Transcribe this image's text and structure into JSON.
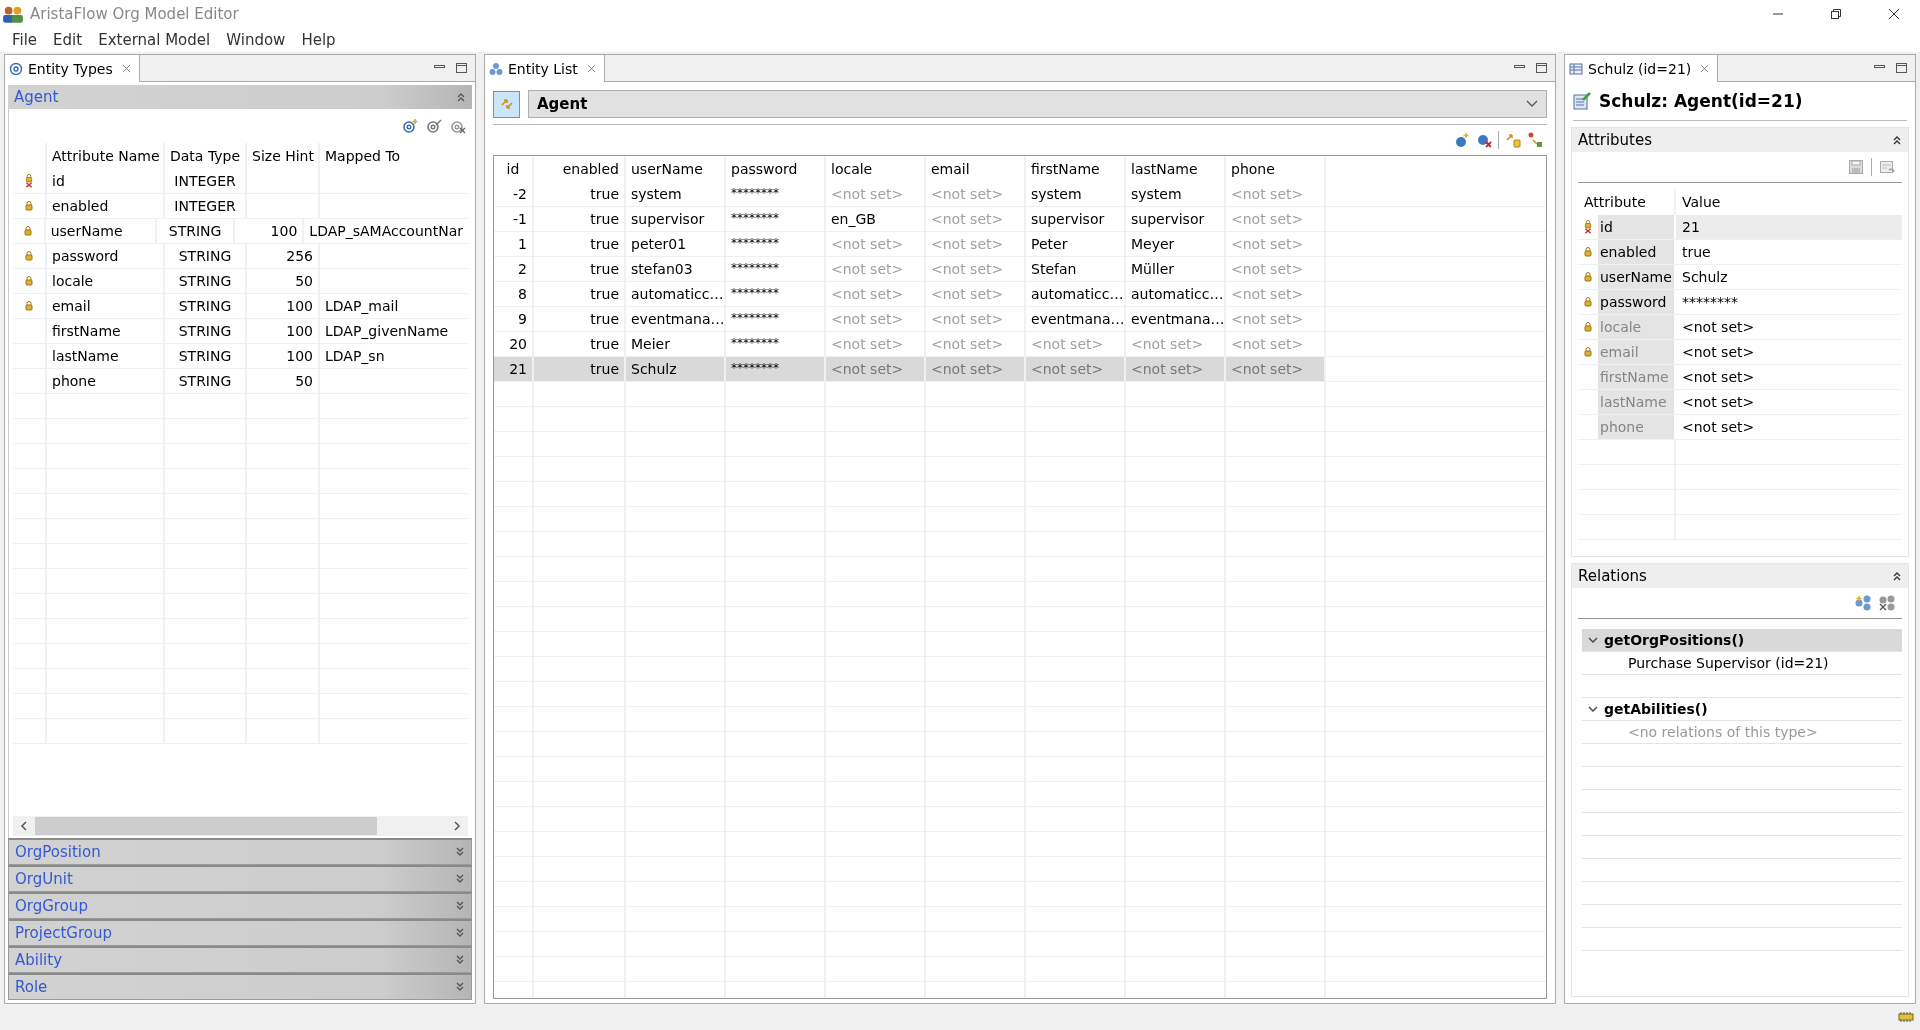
{
  "window": {
    "title": "AristaFlow Org Model Editor"
  },
  "menu": [
    "File",
    "Edit",
    "External Model",
    "Window",
    "Help"
  ],
  "entity_types": {
    "tab": "Entity Types",
    "sections": [
      {
        "label": "Agent",
        "expanded": true
      },
      {
        "label": "OrgPosition",
        "expanded": false
      },
      {
        "label": "OrgUnit",
        "expanded": false
      },
      {
        "label": "OrgGroup",
        "expanded": false
      },
      {
        "label": "ProjectGroup",
        "expanded": false
      },
      {
        "label": "Ability",
        "expanded": false
      },
      {
        "label": "Role",
        "expanded": false
      }
    ],
    "columns": [
      "Attribute Name",
      "Data Type",
      "Size Hint",
      "Mapped To"
    ],
    "rows": [
      {
        "kind": "key",
        "name": "id",
        "data_type": "INTEGER",
        "size_hint": "",
        "mapped_to": ""
      },
      {
        "kind": "locked",
        "name": "enabled",
        "data_type": "INTEGER",
        "size_hint": "",
        "mapped_to": ""
      },
      {
        "kind": "locked",
        "name": "userName",
        "data_type": "STRING",
        "size_hint": "100",
        "mapped_to": "LDAP_sAMAccountNar"
      },
      {
        "kind": "locked",
        "name": "password",
        "data_type": "STRING",
        "size_hint": "256",
        "mapped_to": ""
      },
      {
        "kind": "locked",
        "name": "locale",
        "data_type": "STRING",
        "size_hint": "50",
        "mapped_to": ""
      },
      {
        "kind": "locked",
        "name": "email",
        "data_type": "STRING",
        "size_hint": "100",
        "mapped_to": "LDAP_mail"
      },
      {
        "kind": "plain",
        "name": "firstName",
        "data_type": "STRING",
        "size_hint": "100",
        "mapped_to": "LDAP_givenName"
      },
      {
        "kind": "plain",
        "name": "lastName",
        "data_type": "STRING",
        "size_hint": "100",
        "mapped_to": "LDAP_sn"
      },
      {
        "kind": "plain",
        "name": "phone",
        "data_type": "STRING",
        "size_hint": "50",
        "mapped_to": ""
      }
    ]
  },
  "entity_list": {
    "tab": "Entity List",
    "entity_type": "Agent",
    "columns": [
      "id",
      "enabled",
      "userName",
      "password",
      "locale",
      "email",
      "firstName",
      "lastName",
      "phone"
    ],
    "rows": [
      {
        "selected": false,
        "cells": [
          {
            "text": "-2",
            "unset": false
          },
          {
            "text": "true",
            "unset": false
          },
          {
            "text": "system",
            "unset": false
          },
          {
            "text": "********",
            "unset": false
          },
          {
            "text": "<not set>",
            "unset": true
          },
          {
            "text": "<not set>",
            "unset": true
          },
          {
            "text": "system",
            "unset": false
          },
          {
            "text": "system",
            "unset": false
          },
          {
            "text": "<not set>",
            "unset": true
          }
        ]
      },
      {
        "selected": false,
        "cells": [
          {
            "text": "-1",
            "unset": false
          },
          {
            "text": "true",
            "unset": false
          },
          {
            "text": "supervisor",
            "unset": false
          },
          {
            "text": "********",
            "unset": false
          },
          {
            "text": "en_GB",
            "unset": false
          },
          {
            "text": "<not set>",
            "unset": true
          },
          {
            "text": "supervisor",
            "unset": false
          },
          {
            "text": "supervisor",
            "unset": false
          },
          {
            "text": "<not set>",
            "unset": true
          }
        ]
      },
      {
        "selected": false,
        "cells": [
          {
            "text": "1",
            "unset": false
          },
          {
            "text": "true",
            "unset": false
          },
          {
            "text": "peter01",
            "unset": false
          },
          {
            "text": "********",
            "unset": false
          },
          {
            "text": "<not set>",
            "unset": true
          },
          {
            "text": "<not set>",
            "unset": true
          },
          {
            "text": "Peter",
            "unset": false
          },
          {
            "text": "Meyer",
            "unset": false
          },
          {
            "text": "<not set>",
            "unset": true
          }
        ]
      },
      {
        "selected": false,
        "cells": [
          {
            "text": "2",
            "unset": false
          },
          {
            "text": "true",
            "unset": false
          },
          {
            "text": "stefan03",
            "unset": false
          },
          {
            "text": "********",
            "unset": false
          },
          {
            "text": "<not set>",
            "unset": true
          },
          {
            "text": "<not set>",
            "unset": true
          },
          {
            "text": "Stefan",
            "unset": false
          },
          {
            "text": "Müller",
            "unset": false
          },
          {
            "text": "<not set>",
            "unset": true
          }
        ]
      },
      {
        "selected": false,
        "cells": [
          {
            "text": "8",
            "unset": false
          },
          {
            "text": "true",
            "unset": false
          },
          {
            "text": "automaticc…",
            "unset": false
          },
          {
            "text": "********",
            "unset": false
          },
          {
            "text": "<not set>",
            "unset": true
          },
          {
            "text": "<not set>",
            "unset": true
          },
          {
            "text": "automaticc…",
            "unset": false
          },
          {
            "text": "automaticc…",
            "unset": false
          },
          {
            "text": "<not set>",
            "unset": true
          }
        ]
      },
      {
        "selected": false,
        "cells": [
          {
            "text": "9",
            "unset": false
          },
          {
            "text": "true",
            "unset": false
          },
          {
            "text": "eventmana…",
            "unset": false
          },
          {
            "text": "********",
            "unset": false
          },
          {
            "text": "<not set>",
            "unset": true
          },
          {
            "text": "<not set>",
            "unset": true
          },
          {
            "text": "eventmana…",
            "unset": false
          },
          {
            "text": "eventmana…",
            "unset": false
          },
          {
            "text": "<not set>",
            "unset": true
          }
        ]
      },
      {
        "selected": false,
        "cells": [
          {
            "text": "20",
            "unset": false
          },
          {
            "text": "true",
            "unset": false
          },
          {
            "text": "Meier",
            "unset": false
          },
          {
            "text": "********",
            "unset": false
          },
          {
            "text": "<not set>",
            "unset": true
          },
          {
            "text": "<not set>",
            "unset": true
          },
          {
            "text": "<not set>",
            "unset": true
          },
          {
            "text": "<not set>",
            "unset": true
          },
          {
            "text": "<not set>",
            "unset": true
          }
        ]
      },
      {
        "selected": true,
        "cells": [
          {
            "text": "21",
            "unset": false
          },
          {
            "text": "true",
            "unset": false
          },
          {
            "text": "Schulz",
            "unset": false
          },
          {
            "text": "********",
            "unset": false
          },
          {
            "text": "<not set>",
            "unset": true
          },
          {
            "text": "<not set>",
            "unset": true
          },
          {
            "text": "<not set>",
            "unset": true
          },
          {
            "text": "<not set>",
            "unset": true
          },
          {
            "text": "<not set>",
            "unset": true
          }
        ]
      }
    ]
  },
  "detail": {
    "tab": "Schulz (id=21)",
    "heading": "Schulz: Agent(id=21)",
    "attributes": {
      "title": "Attributes",
      "expanded": true,
      "columns": [
        "Attribute",
        "Value"
      ],
      "rows": [
        {
          "kind": "key",
          "name": "id",
          "value": "21",
          "greyed": false,
          "selected": true
        },
        {
          "kind": "locked",
          "name": "enabled",
          "value": "true",
          "greyed": false,
          "selected": false
        },
        {
          "kind": "locked",
          "name": "userName",
          "value": "Schulz",
          "greyed": false,
          "selected": false
        },
        {
          "kind": "locked",
          "name": "password",
          "value": "********",
          "greyed": false,
          "selected": false
        },
        {
          "kind": "locked",
          "name": "locale",
          "value": "<not set>",
          "greyed": true,
          "selected": false
        },
        {
          "kind": "locked",
          "name": "email",
          "value": "<not set>",
          "greyed": true,
          "selected": false
        },
        {
          "kind": "plain",
          "name": "firstName",
          "value": "<not set>",
          "greyed": true,
          "selected": false
        },
        {
          "kind": "plain",
          "name": "lastName",
          "value": "<not set>",
          "greyed": true,
          "selected": false
        },
        {
          "kind": "plain",
          "name": "phone",
          "value": "<not set>",
          "greyed": true,
          "selected": false
        }
      ]
    },
    "relations": {
      "title": "Relations",
      "expanded": true,
      "groups": [
        {
          "label": "getOrgPositions()",
          "expanded": true,
          "selected": true,
          "items": [
            {
              "kind": "entry",
              "text": "Purchase Supervisor (id=21)"
            }
          ]
        },
        {
          "label": "getAbilities()",
          "expanded": true,
          "selected": false,
          "items": [
            {
              "kind": "empty",
              "text": "<no relations of this type>"
            }
          ]
        }
      ]
    }
  }
}
